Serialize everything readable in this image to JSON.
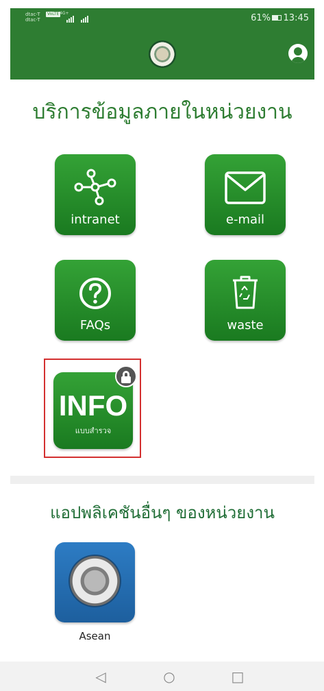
{
  "status_bar": {
    "carrier_top": "dtac-T",
    "carrier_bottom": "dtac-T",
    "volte": "VoLTE",
    "network": "4G+",
    "battery_percent": "61%",
    "time": "13:45"
  },
  "app_bar": {
    "logo": "department-seal-icon",
    "profile": "account-circle-icon"
  },
  "main": {
    "title": "บริการข้อมูลภายในหน่วยงาน",
    "tiles": [
      {
        "label": "intranet",
        "icon": "network-nodes-icon"
      },
      {
        "label": "e-mail",
        "icon": "envelope-icon"
      },
      {
        "label": "FAQs",
        "icon": "question-circle-icon"
      },
      {
        "label": "waste",
        "icon": "recycle-bin-icon"
      }
    ],
    "info_tile": {
      "title": "INFO",
      "subtitle": "แบบสำรวจ",
      "locked": true,
      "icon": "lock-icon"
    }
  },
  "other_apps": {
    "title": "แอปพลิเคชันอื่นๆ ของหน่วยงาน",
    "apps": [
      {
        "label": "Asean",
        "icon": "asean-seal-icon"
      }
    ]
  },
  "nav_bar": {
    "back": "◁",
    "home": "○",
    "recent": "□"
  },
  "colors": {
    "primary_green": "#2e7d32",
    "tile_green": "#1f8a26",
    "highlight_red": "#d32f2f",
    "asean_blue": "#2168ab"
  }
}
